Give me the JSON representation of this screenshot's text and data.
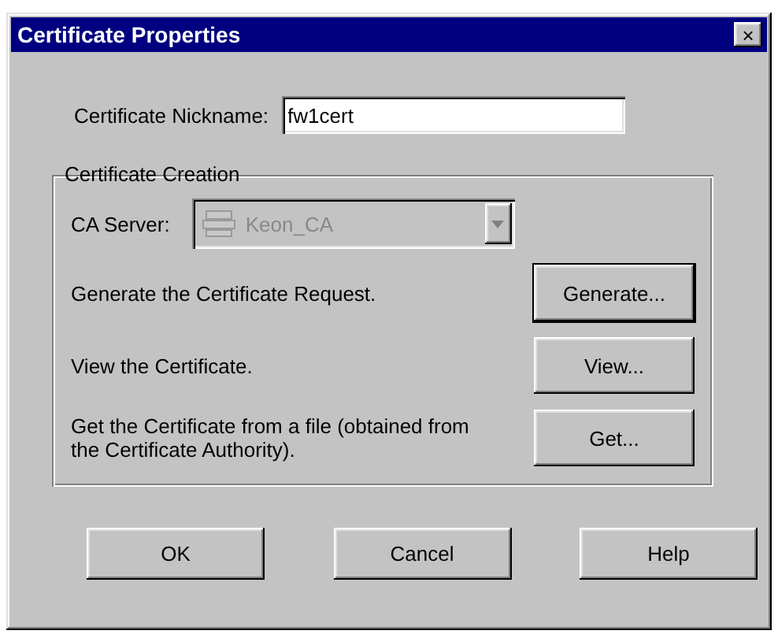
{
  "window": {
    "title": "Certificate Properties",
    "close": "×"
  },
  "nickname": {
    "label": "Certificate Nickname:",
    "value": "fw1cert"
  },
  "group": {
    "title": "Certificate Creation",
    "ca_server": {
      "label": "CA Server:",
      "value": "Keon_CA",
      "disabled": true
    },
    "actions": [
      {
        "text": "Generate the Certificate Request.",
        "button": "Generate...",
        "default": true
      },
      {
        "text": "View the Certificate.",
        "button": "View...",
        "default": false
      },
      {
        "text": "Get the Certificate from a file (obtained from the Certificate Authority).",
        "button": "Get...",
        "default": false
      }
    ]
  },
  "buttons": [
    "OK",
    "Cancel",
    "Help"
  ]
}
